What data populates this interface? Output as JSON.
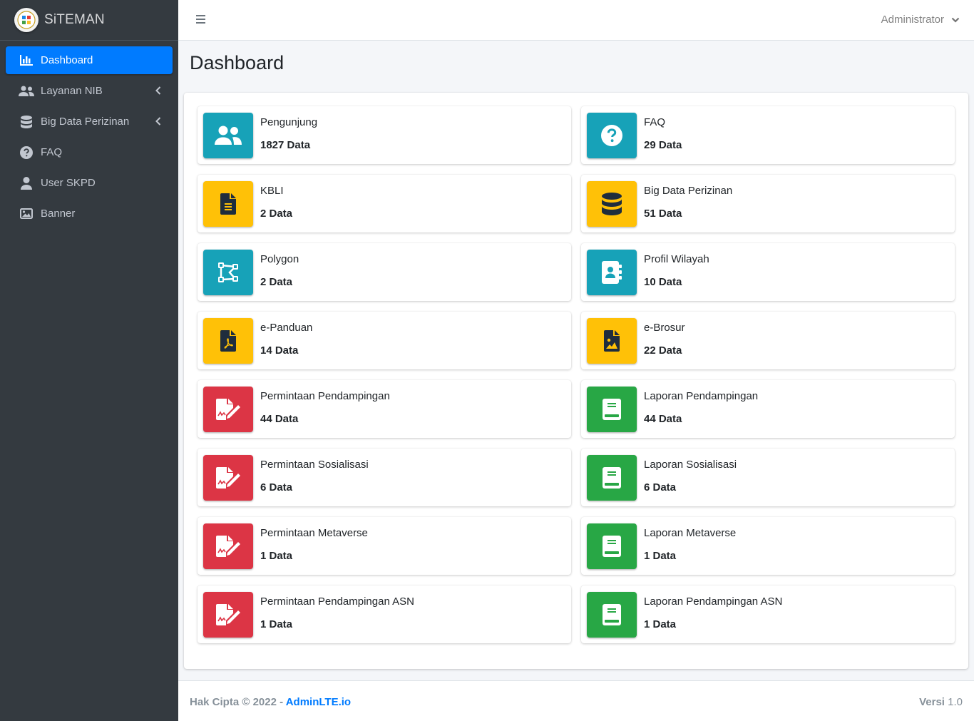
{
  "brand": {
    "name": "SiTEMAN"
  },
  "sidebar": {
    "items": [
      {
        "label": "Dashboard",
        "icon": "chart-bar-icon",
        "active": true
      },
      {
        "label": "Layanan NIB",
        "icon": "users-icon",
        "has_submenu": true
      },
      {
        "label": "Big Data Perizinan",
        "icon": "database-icon",
        "has_submenu": true
      },
      {
        "label": "FAQ",
        "icon": "question-circle-icon"
      },
      {
        "label": "User SKPD",
        "icon": "user-icon"
      },
      {
        "label": "Banner",
        "icon": "image-icon"
      }
    ]
  },
  "topbar": {
    "user": "Administrator"
  },
  "page": {
    "title": "Dashboard"
  },
  "stats": [
    {
      "label": "Pengunjung",
      "value": "1827 Data",
      "color": "teal",
      "icon": "users-icon"
    },
    {
      "label": "FAQ",
      "value": "29 Data",
      "color": "teal",
      "icon": "question-circle-icon"
    },
    {
      "label": "KBLI",
      "value": "2 Data",
      "color": "yellow",
      "icon": "file-alt-icon"
    },
    {
      "label": "Big Data Perizinan",
      "value": "51 Data",
      "color": "yellow",
      "icon": "database-icon"
    },
    {
      "label": "Polygon",
      "value": "2 Data",
      "color": "teal",
      "icon": "draw-polygon-icon"
    },
    {
      "label": "Profil Wilayah",
      "value": "10 Data",
      "color": "teal",
      "icon": "address-book-icon"
    },
    {
      "label": "e-Panduan",
      "value": "14 Data",
      "color": "yellow",
      "icon": "file-pdf-icon"
    },
    {
      "label": "e-Brosur",
      "value": "22 Data",
      "color": "yellow",
      "icon": "file-image-icon"
    },
    {
      "label": "Permintaan Pendampingan",
      "value": "44 Data",
      "color": "red",
      "icon": "file-signature-icon"
    },
    {
      "label": "Laporan Pendampingan",
      "value": "44 Data",
      "color": "green",
      "icon": "book-icon"
    },
    {
      "label": "Permintaan Sosialisasi",
      "value": "6 Data",
      "color": "red",
      "icon": "file-signature-icon"
    },
    {
      "label": "Laporan Sosialisasi",
      "value": "6 Data",
      "color": "green",
      "icon": "book-icon"
    },
    {
      "label": "Permintaan Metaverse",
      "value": "1 Data",
      "color": "red",
      "icon": "file-signature-icon"
    },
    {
      "label": "Laporan Metaverse",
      "value": "1 Data",
      "color": "green",
      "icon": "book-icon"
    },
    {
      "label": "Permintaan Pendampingan ASN",
      "value": "1 Data",
      "color": "red",
      "icon": "file-signature-icon"
    },
    {
      "label": "Laporan Pendampingan ASN",
      "value": "1 Data",
      "color": "green",
      "icon": "book-icon"
    }
  ],
  "footer": {
    "copyright": "Hak Cipta © 2022 - ",
    "link": "AdminLTE.io",
    "version_label": "Versi",
    "version": " 1.0"
  },
  "colors": {
    "primary": "#007bff",
    "teal": "#17a2b8",
    "yellow": "#ffc107",
    "red": "#dc3545",
    "green": "#28a745",
    "sidebar": "#343a40"
  }
}
